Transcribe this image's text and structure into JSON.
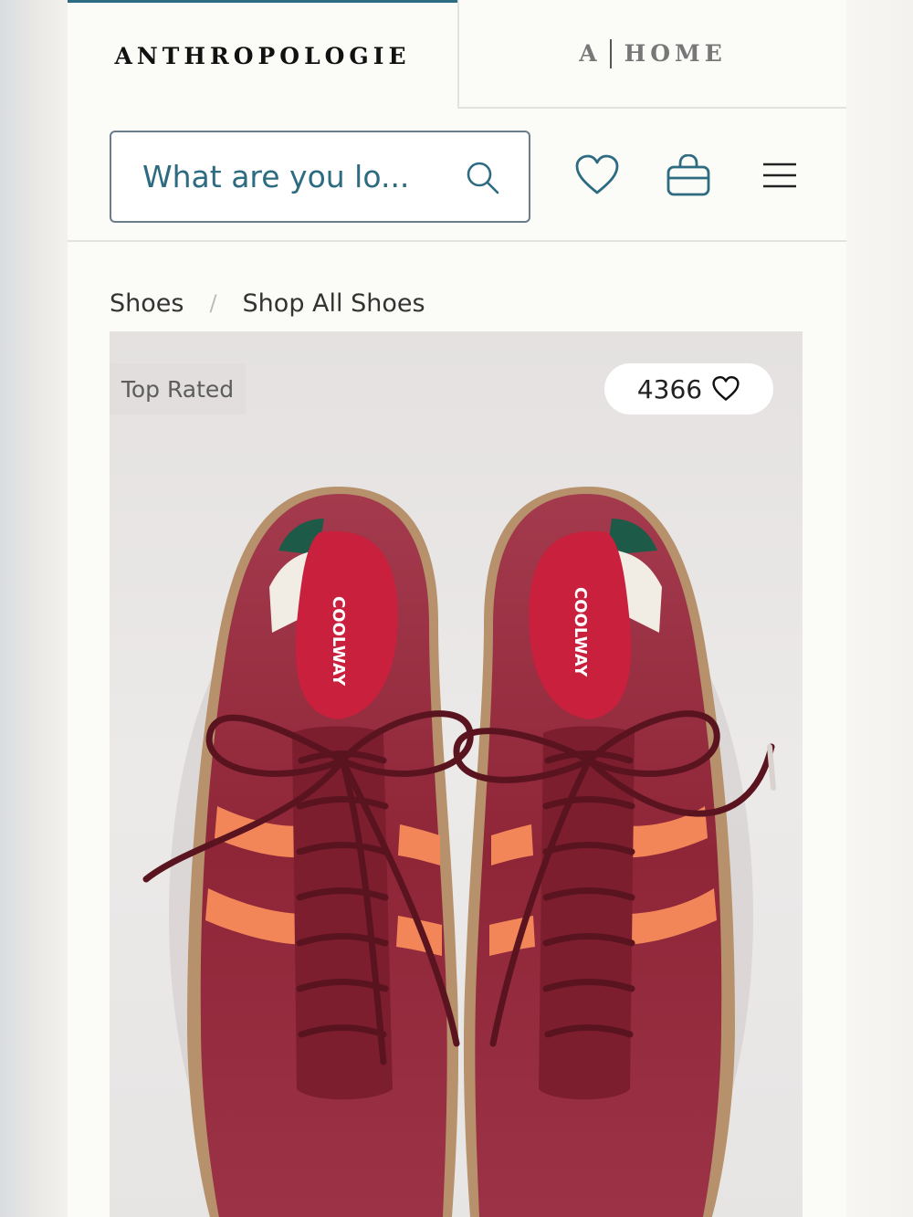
{
  "brand_tabs": {
    "anthropologie": "ANTHROPOLOGIE",
    "home_mark": "A",
    "home_label": "HOME"
  },
  "header": {
    "search_placeholder": "What are you lo...",
    "icons": [
      "search-icon",
      "heart-icon",
      "shopping-bag-icon",
      "hamburger-menu-icon"
    ]
  },
  "breadcrumb": {
    "items": [
      "Shoes",
      "Shop All Shoes"
    ],
    "separator": "/"
  },
  "product": {
    "badge": "Top Rated",
    "favorites_count": "4366",
    "insole_text": "COOLWAY"
  },
  "colors": {
    "accent": "#2d6b80",
    "shoe": "#8e2638",
    "stripe": "#f28659",
    "heel_tab": "#1e5a48",
    "lace": "#5a1420"
  }
}
